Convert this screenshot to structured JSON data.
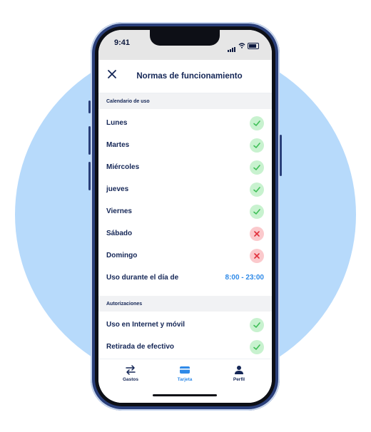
{
  "status_bar": {
    "time": "9:41"
  },
  "header": {
    "title": "Normas de funcionamiento",
    "close_icon": "close-icon"
  },
  "sections": {
    "calendar": {
      "title": "Calendario de uso",
      "days": [
        {
          "label": "Lunes",
          "status": "allowed"
        },
        {
          "label": "Martes",
          "status": "allowed"
        },
        {
          "label": "Miércoles",
          "status": "allowed"
        },
        {
          "label": "jueves",
          "status": "allowed"
        },
        {
          "label": "Viernes",
          "status": "allowed"
        },
        {
          "label": "Sábado",
          "status": "blocked"
        },
        {
          "label": "Domingo",
          "status": "blocked"
        }
      ],
      "usage_hours": {
        "label": "Uso durante el día de",
        "value": "8:00 - 23:00"
      }
    },
    "authorizations": {
      "title": "Autorizaciones",
      "items": [
        {
          "label": "Uso en Internet y móvil",
          "status": "allowed"
        },
        {
          "label": "Retirada de efectivo",
          "status": "allowed"
        }
      ]
    }
  },
  "tabbar": {
    "tabs": [
      {
        "label": "Gastos",
        "icon": "arrows-icon",
        "active": false
      },
      {
        "label": "Tarjeta",
        "icon": "card-icon",
        "active": true
      },
      {
        "label": "Perfil",
        "icon": "person-icon",
        "active": false
      }
    ]
  },
  "colors": {
    "background_circle": "#b7dafb",
    "phone_frame": "#2a3f7a",
    "text_primary": "#142656",
    "accent": "#2f8ae8",
    "allowed_bg": "#c8f2cf",
    "allowed_check": "#3fbf57",
    "blocked_bg": "#fbc9cc",
    "blocked_x": "#e0303b"
  }
}
